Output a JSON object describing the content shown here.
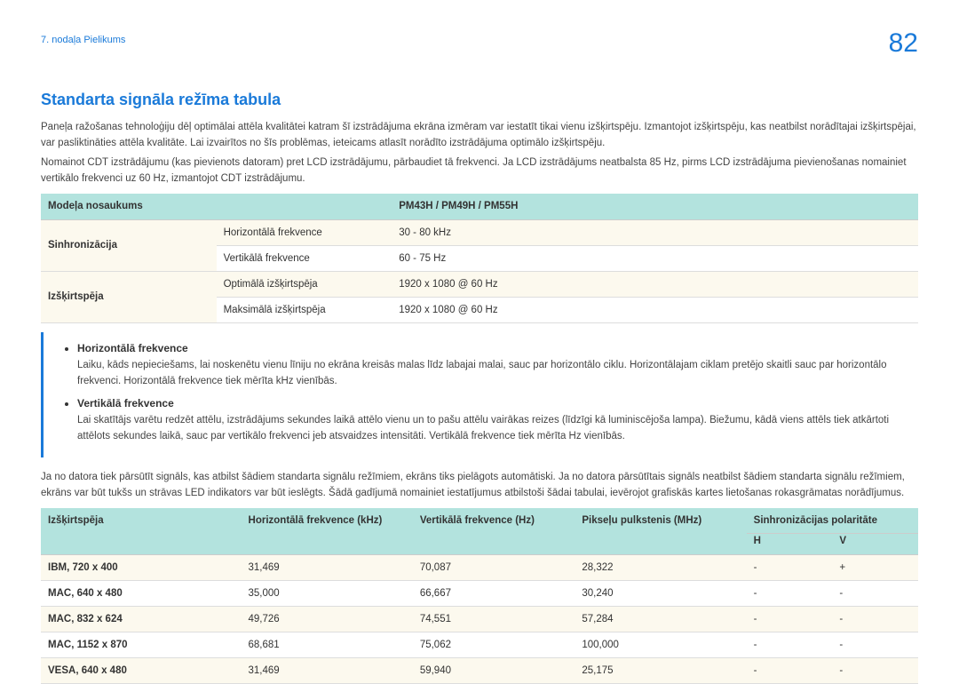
{
  "header": {
    "chapter": "7. nodaļa Pielikums",
    "page": "82"
  },
  "title": "Standarta signāla režīma tabula",
  "p1": "Paneļa ražošanas tehnoloģiju dēļ optimālai attēla kvalitātei katram šī izstrādājuma ekrāna izmēram var iestatīt tikai vienu izšķirtspēju. Izmantojot izšķirtspēju, kas neatbilst norādītajai izšķirtspējai, var pasliktināties attēla kvalitāte. Lai izvairītos no šīs problēmas, ieteicams atlasīt norādīto izstrādājuma optimālo izšķirtspēju.",
  "p2": "Nomainot CDT izstrādājumu (kas pievienots datoram) pret LCD izstrādājumu, pārbaudiet tā frekvenci. Ja LCD izstrādājums neatbalsta 85 Hz, pirms LCD izstrādājuma pievienošanas nomainiet vertikālo frekvenci uz 60 Hz, izmantojot CDT izstrādājumu.",
  "spec": {
    "h1": "Modeļa nosaukums",
    "h2": "PM43H / PM49H / PM55H",
    "r1a": "Sinhronizācija",
    "r1b": "Horizontālā frekvence",
    "r1c": "30 - 80 kHz",
    "r2b": "Vertikālā frekvence",
    "r2c": "60 - 75 Hz",
    "r3a": "Izšķirtspēja",
    "r3b": "Optimālā izšķirtspēja",
    "r3c": "1920 x 1080 @ 60 Hz",
    "r4b": "Maksimālā izšķirtspēja",
    "r4c": "1920 x 1080 @ 60 Hz"
  },
  "note": {
    "li1": "Horizontālā frekvence",
    "d1": "Laiku, kāds nepieciešams, lai noskenētu vienu līniju no ekrāna kreisās malas līdz labajai malai, sauc par horizontālo ciklu. Horizontālajam ciklam pretējo skaitli sauc par horizontālo frekvenci. Horizontālā frekvence tiek mērīta kHz vienībās.",
    "li2": "Vertikālā frekvence",
    "d2": "Lai skatītājs varētu redzēt attēlu, izstrādājums sekundes laikā attēlo vienu un to pašu attēlu vairākas reizes (līdzīgi kā luminiscējoša lampa). Biežumu, kādā viens attēls tiek atkārtoti attēlots sekundes laikā, sauc par vertikālo frekvenci jeb atsvaidzes intensitāti. Vertikālā frekvence tiek mērīta Hz vienībās."
  },
  "p3": "Ja no datora tiek pārsūtīt signāls, kas atbilst šādiem standarta signālu režīmiem, ekrāns tiks pielāgots automātiski. Ja no datora pārsūtītais signāls neatbilst šādiem standarta signālu režīmiem, ekrāns var būt tukšs un strāvas LED indikators var būt ieslēgts. Šādā gadījumā nomainiet iestatījumus atbilstoši šādai tabulai, ievērojot grafiskās kartes lietošanas rokasgrāmatas norādījumus.",
  "sig": {
    "h_res": "Izšķirtspēja",
    "h_hf": "Horizontālā frekvence (kHz)",
    "h_vf": "Vertikālā frekvence (Hz)",
    "h_pc": "Pikseļu pulkstenis (MHz)",
    "h_sp": "Sinhronizācijas polaritāte",
    "h_h": "H",
    "h_v": "V",
    "rows": [
      {
        "res": "IBM, 720 x 400",
        "hf": "31,469",
        "vf": "70,087",
        "pc": "28,322",
        "h": "-",
        "v": "+"
      },
      {
        "res": "MAC, 640 x 480",
        "hf": "35,000",
        "vf": "66,667",
        "pc": "30,240",
        "h": "-",
        "v": "-"
      },
      {
        "res": "MAC, 832 x 624",
        "hf": "49,726",
        "vf": "74,551",
        "pc": "57,284",
        "h": "-",
        "v": "-"
      },
      {
        "res": "MAC, 1152 x 870",
        "hf": "68,681",
        "vf": "75,062",
        "pc": "100,000",
        "h": "-",
        "v": "-"
      },
      {
        "res": "VESA, 640 x 480",
        "hf": "31,469",
        "vf": "59,940",
        "pc": "25,175",
        "h": "-",
        "v": "-"
      }
    ]
  }
}
